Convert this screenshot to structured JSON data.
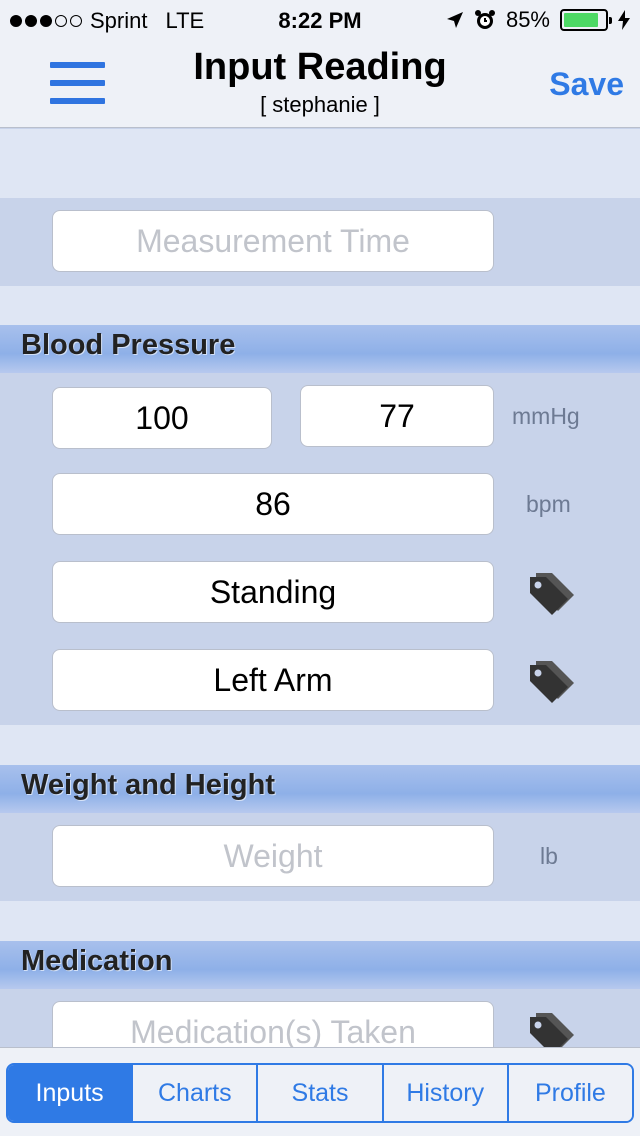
{
  "status_bar": {
    "carrier": "Sprint",
    "network": "LTE",
    "time": "8:22 PM",
    "battery_percent": "85%",
    "battery_level": 0.85
  },
  "nav": {
    "title": "Input Reading",
    "subtitle": "[ stephanie ]",
    "save_label": "Save"
  },
  "measurement_time": {
    "placeholder": "Measurement Time"
  },
  "blood_pressure": {
    "header": "Blood Pressure",
    "systolic": "100",
    "diastolic": "77",
    "pressure_unit": "mmHg",
    "pulse": "86",
    "pulse_unit": "bpm",
    "position": "Standing",
    "location": "Left Arm"
  },
  "weight_height": {
    "header": "Weight and Height",
    "weight_placeholder": "Weight",
    "weight_unit": "lb"
  },
  "medication": {
    "header": "Medication",
    "placeholder": "Medication(s) Taken"
  },
  "tabs": [
    {
      "label": "Inputs",
      "active": true
    },
    {
      "label": "Charts",
      "active": false
    },
    {
      "label": "Stats",
      "active": false
    },
    {
      "label": "History",
      "active": false
    },
    {
      "label": "Profile",
      "active": false
    }
  ],
  "colors": {
    "accent": "#2f7ae5",
    "section_header": "#8eb0e8",
    "band": "#c8d3ea",
    "spacer": "#dfe6f4"
  }
}
